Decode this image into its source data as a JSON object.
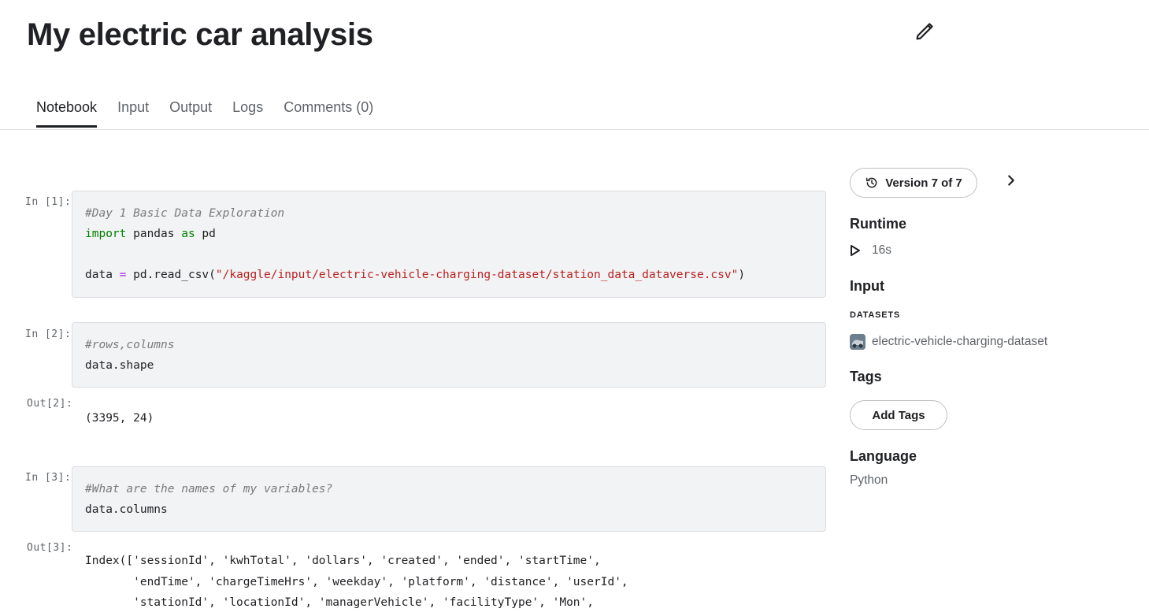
{
  "title": "My electric car analysis",
  "tabs": [
    {
      "label": "Notebook",
      "active": true
    },
    {
      "label": "Input",
      "active": false
    },
    {
      "label": "Output",
      "active": false
    },
    {
      "label": "Logs",
      "active": false
    },
    {
      "label": "Comments (0)",
      "active": false
    }
  ],
  "cells": [
    {
      "prompt": "In [1]:",
      "code": {
        "comment": "#Day 1 Basic Data Exploration",
        "import_kw": "import",
        "import_mod": " pandas ",
        "as_kw": "as",
        "import_alias": " pd",
        "assign_lhs": "data ",
        "assign_op": "=",
        "assign_call": " pd.read_csv(",
        "assign_str": "\"/kaggle/input/electric-vehicle-charging-dataset/station_data_dataverse.csv\"",
        "assign_close": ")"
      }
    },
    {
      "prompt": "In [2]:",
      "code": {
        "comment": "#rows,columns",
        "line": "data.shape"
      },
      "out_prompt": "Out[2]:",
      "output": "(3395, 24)"
    },
    {
      "prompt": "In [3]:",
      "code": {
        "comment": "#What are the names of my variables?",
        "line": "data.columns"
      },
      "out_prompt": "Out[3]:",
      "output_lines": [
        "Index(['sessionId', 'kwhTotal', 'dollars', 'created', 'ended', 'startTime',",
        "       'endTime', 'chargeTimeHrs', 'weekday', 'platform', 'distance', 'userId',",
        "       'stationId', 'locationId', 'managerVehicle', 'facilityType', 'Mon',"
      ]
    }
  ],
  "sidebar": {
    "version_label": "Version 7 of 7",
    "runtime_heading": "Runtime",
    "runtime_value": "16s",
    "input_heading": "Input",
    "datasets_label": "DATASETS",
    "dataset_name": "electric-vehicle-charging-dataset",
    "tags_heading": "Tags",
    "add_tags_label": "Add Tags",
    "language_heading": "Language",
    "language_value": "Python"
  },
  "icons": {
    "edit": "pencil-icon",
    "history": "history-icon",
    "next": "chevron-right-icon",
    "run": "play-icon",
    "dataset": "dataset-thumbnail"
  },
  "colors": {
    "text": "#202124",
    "muted": "#5f6368",
    "cell_bg": "#f1f3f4",
    "border": "#dadce0",
    "keyword": "#008000",
    "string": "#ba2121",
    "operator": "#aa22ff",
    "comment": "#7a7a7a"
  }
}
